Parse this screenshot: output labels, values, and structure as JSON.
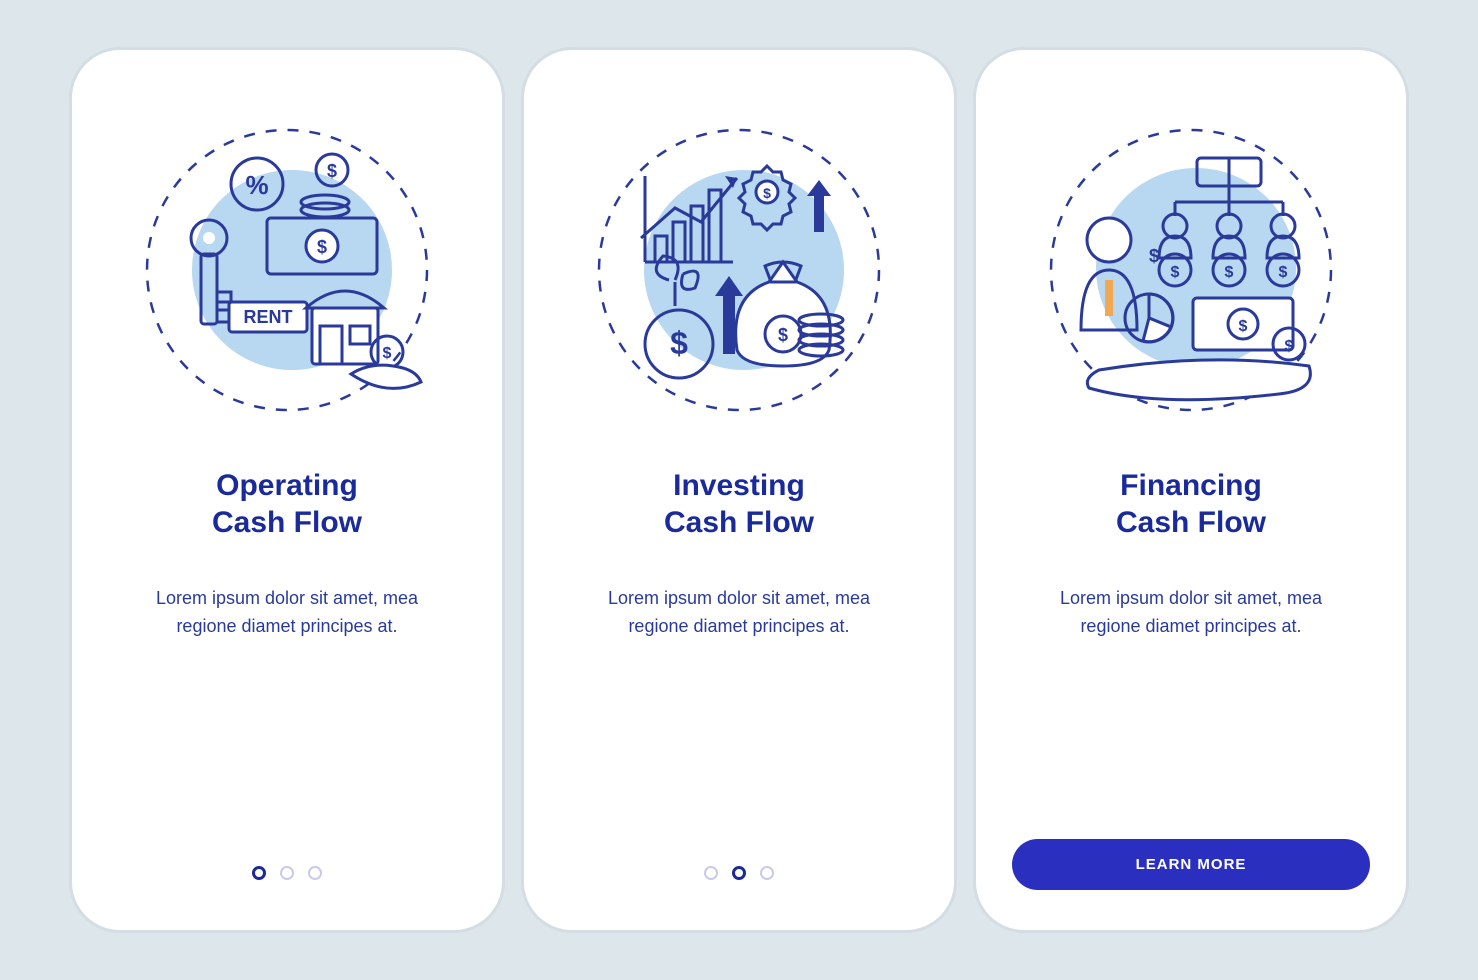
{
  "colors": {
    "background": "#dde6ea",
    "card": "#ffffff",
    "heading": "#1a2a9a",
    "body": "#2a3a9a",
    "accent_blue": "#b8d7f0",
    "accent_orange": "#f0a952",
    "cta": "#2a2fbf"
  },
  "screens": [
    {
      "illustration": "operating-cash-flow-icon",
      "rent_label": "RENT",
      "heading": "Operating\nCash Flow",
      "body": "Lorem ipsum dolor sit amet, mea regione diamet principes at.",
      "active_dot": 0
    },
    {
      "illustration": "investing-cash-flow-icon",
      "heading": "Investing\nCash Flow",
      "body": "Lorem ipsum dolor sit amet, mea regione diamet principes at.",
      "active_dot": 1
    },
    {
      "illustration": "financing-cash-flow-icon",
      "heading": "Financing\nCash Flow",
      "body": "Lorem ipsum dolor sit amet, mea regione diamet principes at.",
      "cta_label": "LEARN MORE"
    }
  ]
}
